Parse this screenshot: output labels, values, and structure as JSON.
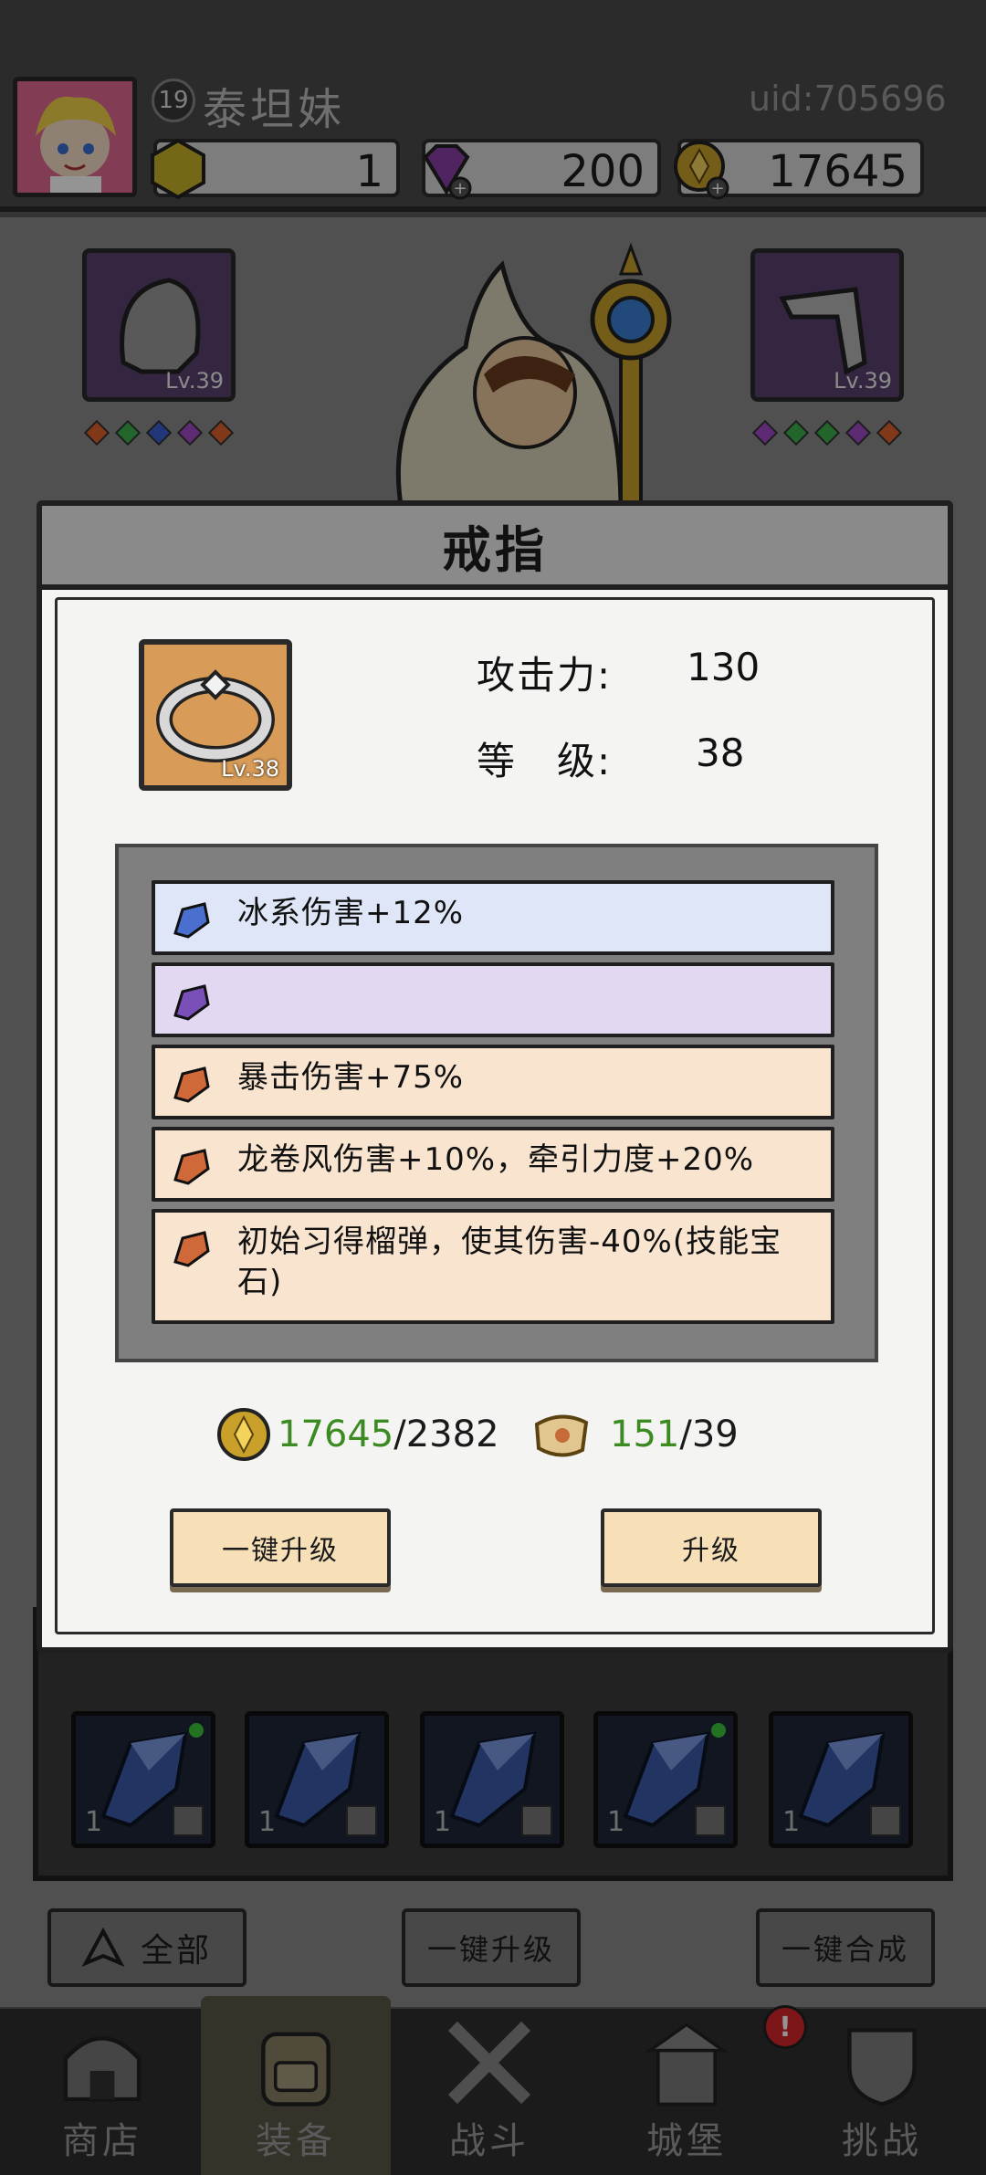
{
  "header": {
    "player_level": "19",
    "player_name": "泰坦妹",
    "uid": "uid:705696",
    "resources": [
      {
        "name": "yellow-gem",
        "value": "1"
      },
      {
        "name": "diamond",
        "value": "200"
      },
      {
        "name": "gold-coin",
        "value": "17645"
      }
    ]
  },
  "equipment": {
    "left_slot_level": "Lv.39",
    "right_slot_level": "Lv.39"
  },
  "dialog": {
    "title": "戒指",
    "item_level": "Lv.38",
    "stats": [
      {
        "label": "攻击力:",
        "value": "130"
      },
      {
        "label": "等　级:",
        "value": "38"
      }
    ],
    "affixes": [
      {
        "text": "冰系伤害+12%",
        "color": "#4a6fcf",
        "bg": "#dfe6f7"
      },
      {
        "text": "",
        "color": "#7a4fb8",
        "bg": "#e3d8f2"
      },
      {
        "text": "暴击伤害+75%",
        "color": "#d0693a",
        "bg": "#f8e4cf"
      },
      {
        "text": "龙卷风伤害+10%，牵引力度+20%",
        "color": "#d0693a",
        "bg": "#f8e4cf"
      },
      {
        "text": "初始习得榴弹，使其伤害-40%(技能宝石)",
        "color": "#d0693a",
        "bg": "#f8e4cf"
      }
    ],
    "cost_gold_have": "17645",
    "cost_gold_need": "/2382",
    "cost_scroll_have": "151",
    "cost_scroll_need": "/39",
    "btn_upgrade_all": "一键升级",
    "btn_upgrade": "升级"
  },
  "inventory": {
    "count": "1"
  },
  "bottom_buttons": {
    "filter_all": "全部",
    "upgrade_all": "一键升级",
    "merge_all": "一键合成"
  },
  "nav": [
    {
      "label": "商店"
    },
    {
      "label": "装备"
    },
    {
      "label": "战斗"
    },
    {
      "label": "城堡"
    },
    {
      "label": "挑战"
    }
  ],
  "colors": {
    "gold_have": "#3c8a22",
    "dialog_btn": "#f7dfb8",
    "alert_badge": "#d8262c"
  }
}
